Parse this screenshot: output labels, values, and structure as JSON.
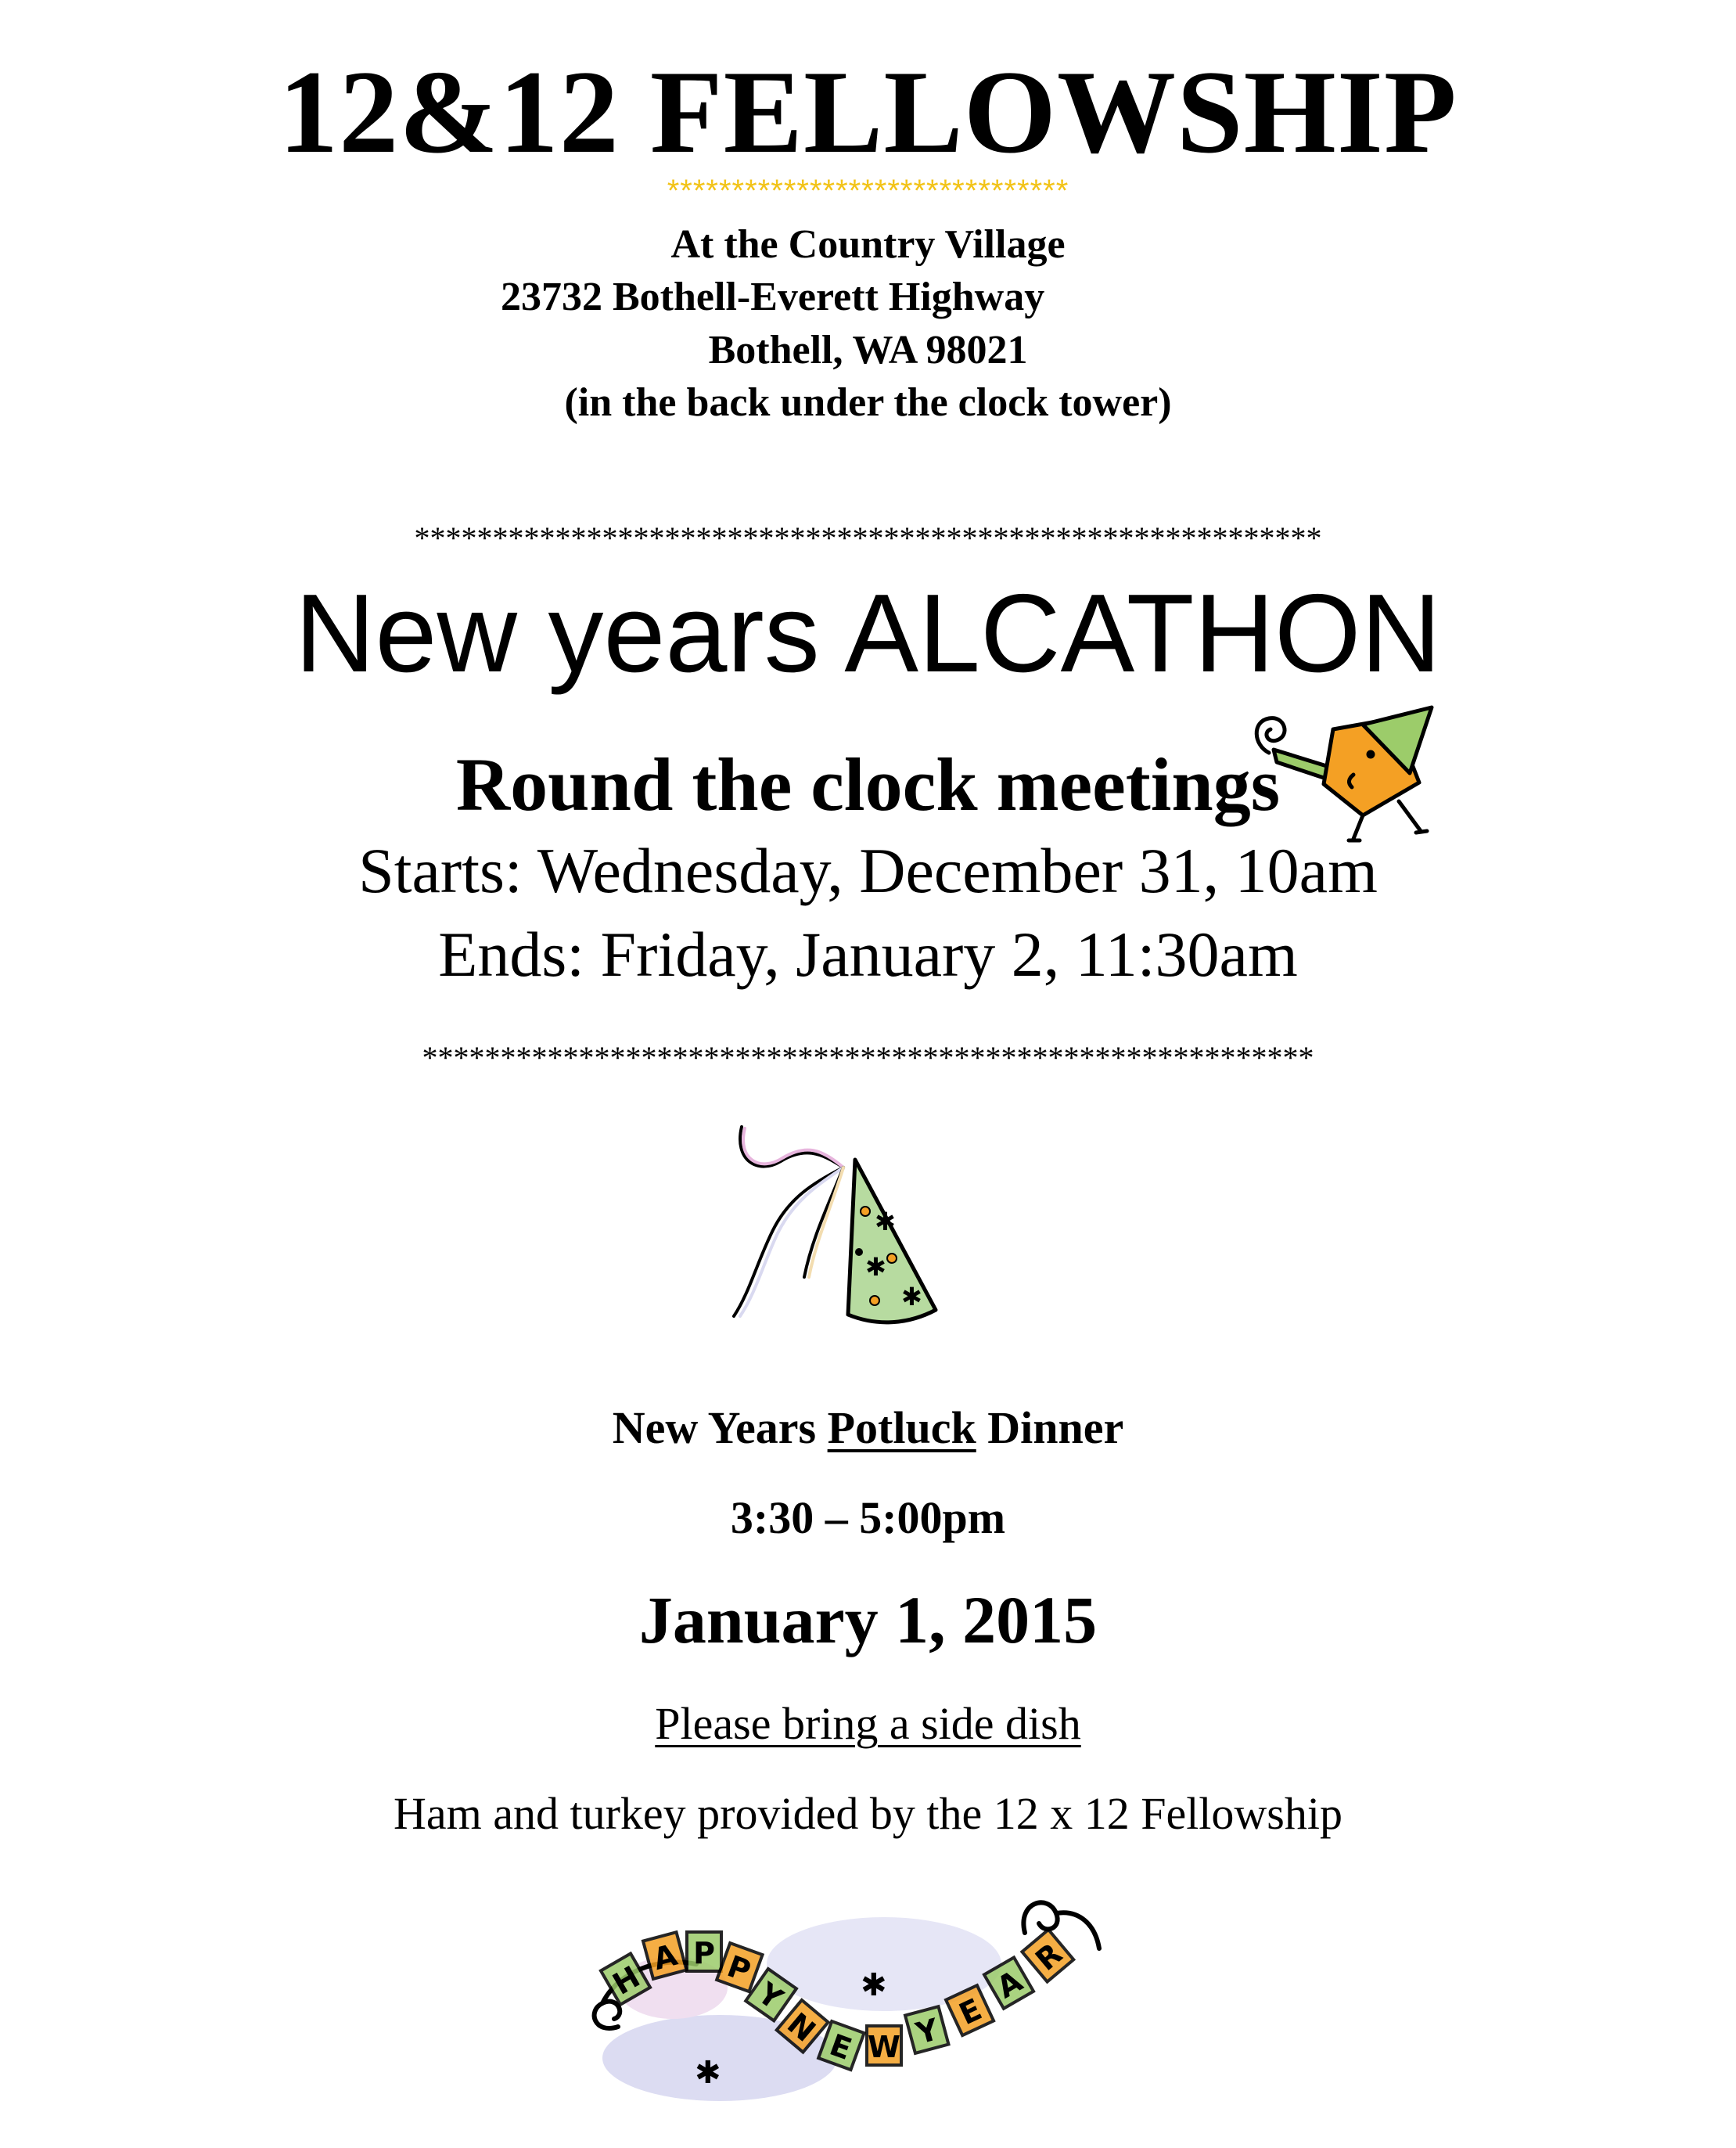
{
  "header": {
    "title": "12&12 FELLOWSHIP",
    "gold_stars": "*******************************"
  },
  "address": {
    "line1": "At the Country Village",
    "line2": "23732 Bothell-Everett Highway",
    "line3": "Bothell, WA 98021",
    "line4": "(in the back under the clock tower)"
  },
  "dividers": {
    "top": "**********************************************************",
    "bottom": "*********************************************************"
  },
  "event": {
    "title": "New years ALCATHON",
    "subtitle": "Round the clock meetings",
    "starts": "Starts:  Wednesday, December 31, 10am",
    "ends": "Ends:  Friday, January 2, 11:30am"
  },
  "dinner": {
    "prefix": "New Years ",
    "underlined": "Potluck",
    "suffix": " Dinner",
    "time": "3:30 – 5:00pm",
    "date": "January 1, 2015",
    "bring": "Please bring a side dish",
    "provided": "Ham and turkey provided by the 12 x 12 Fellowship"
  },
  "banner": {
    "letters": [
      "H",
      "A",
      "P",
      "P",
      "Y",
      "N",
      "E",
      "W",
      "Y",
      "E",
      "A",
      "R"
    ]
  },
  "colors": {
    "gold": "#f2c318",
    "party_orange": "#f4a024",
    "party_green": "#9ccc6a",
    "hat_green": "#b7dba0",
    "cloud_lavender": "#dcdcf2"
  }
}
